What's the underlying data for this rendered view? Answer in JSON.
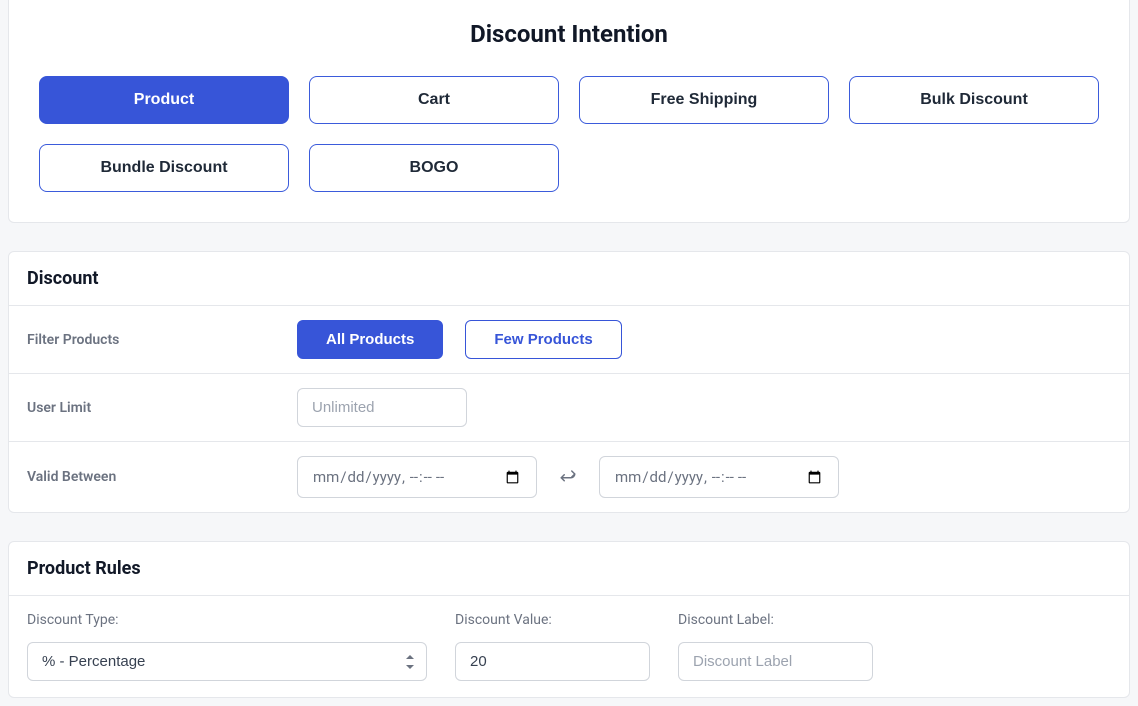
{
  "intention": {
    "title": "Discount Intention",
    "options": {
      "product": "Product",
      "cart": "Cart",
      "free_shipping": "Free Shipping",
      "bulk": "Bulk Discount",
      "bundle": "Bundle Discount",
      "bogo": "BOGO"
    }
  },
  "discount": {
    "title": "Discount",
    "filter_label": "Filter Products",
    "filter_options": {
      "all": "All Products",
      "few": "Few Products"
    },
    "user_limit_label": "User Limit",
    "user_limit_placeholder": "Unlimited",
    "valid_between_label": "Valid Between"
  },
  "rules": {
    "title": "Product Rules",
    "type_label": "Discount Type:",
    "type_value": "% - Percentage",
    "value_label": "Discount Value:",
    "value_value": "20",
    "label_label": "Discount Label:",
    "label_placeholder": "Discount Label"
  }
}
